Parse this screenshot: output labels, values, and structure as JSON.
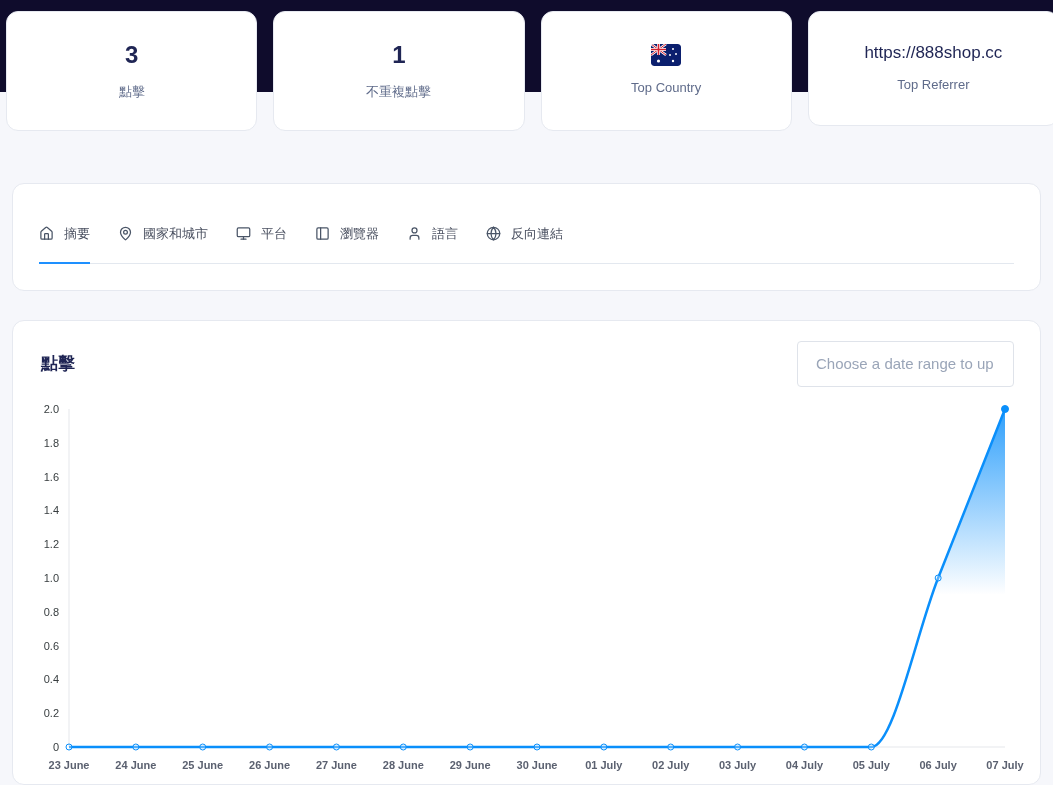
{
  "stats": [
    {
      "kind": "number",
      "value": "3",
      "label": "點擊"
    },
    {
      "kind": "number",
      "value": "1",
      "label": "不重複點擊"
    },
    {
      "kind": "flag",
      "label": "Top Country"
    },
    {
      "kind": "text",
      "value": "https://888shop.cc",
      "label": "Top Referrer"
    }
  ],
  "tabs": [
    {
      "label": "摘要",
      "selected": true
    },
    {
      "label": "國家和城市",
      "selected": false
    },
    {
      "label": "平台",
      "selected": false
    },
    {
      "label": "瀏覽器",
      "selected": false
    },
    {
      "label": "語言",
      "selected": false
    },
    {
      "label": "反向連結",
      "selected": false
    }
  ],
  "clicks_panel": {
    "title": "點擊",
    "date_range": {
      "placeholder": "Choose a date range to up"
    },
    "chart_data": {
      "type": "area",
      "categories": [
        "23 June",
        "24 June",
        "25 June",
        "26 June",
        "27 June",
        "28 June",
        "29 June",
        "30 June",
        "01 July",
        "02 July",
        "03 July",
        "04 July",
        "05 July",
        "06 July",
        "07 July"
      ],
      "series": [
        {
          "color": "#0a8ffb",
          "values": [
            0,
            0,
            0,
            0,
            0,
            0,
            0,
            0,
            0,
            0,
            0,
            0,
            0,
            1,
            2
          ]
        }
      ],
      "ylim": [
        0,
        2
      ],
      "yticks": [
        0,
        0.2,
        0.4,
        0.6,
        0.8,
        {
          "value": 1,
          "label": "1.0"
        },
        1.2,
        1.4,
        1.6,
        1.8,
        {
          "value": 2,
          "label": "2.0"
        }
      ]
    }
  }
}
